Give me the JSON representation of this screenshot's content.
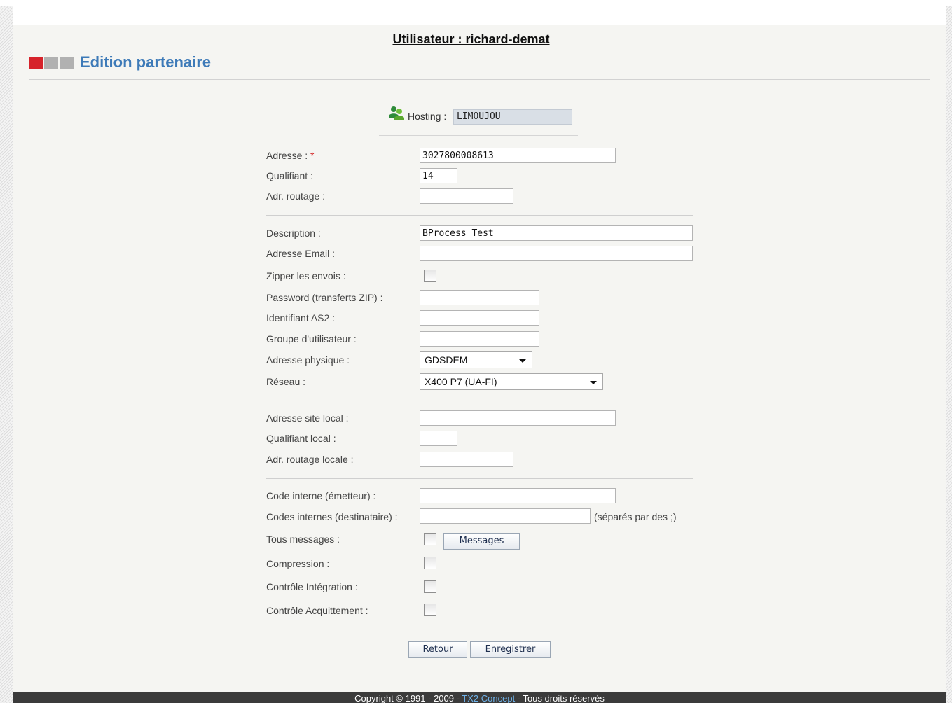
{
  "header": {
    "user_title": "Utilisateur : richard-demat",
    "page_title": "Edition partenaire",
    "logo_colors": [
      "#d6232b",
      "#b1b1b1",
      "#b1b1b1"
    ]
  },
  "hosting": {
    "icon": "users-icon",
    "label": "Hosting :",
    "value": "LIMOUJOU"
  },
  "form": {
    "adresse": {
      "label": "Adresse :",
      "required_mark": "*",
      "value": "3027800008613"
    },
    "qualifiant": {
      "label": "Qualifiant :",
      "value": "14"
    },
    "adr_routage": {
      "label": "Adr. routage :",
      "value": ""
    },
    "description": {
      "label": "Description :",
      "value": "BProcess Test"
    },
    "adresse_email": {
      "label": "Adresse Email :",
      "value": ""
    },
    "zipper": {
      "label": "Zipper les envois :",
      "checked": false
    },
    "password_zip": {
      "label": "Password (transferts ZIP) :",
      "value": ""
    },
    "identifiant_as2": {
      "label": "Identifiant AS2 :",
      "value": ""
    },
    "groupe_utilisateur": {
      "label": "Groupe d'utilisateur :",
      "value": ""
    },
    "adresse_physique": {
      "label": "Adresse physique :",
      "selected": "GDSDEM"
    },
    "reseau": {
      "label": "Réseau :",
      "selected": "X400 P7 (UA-FI)"
    },
    "adresse_site_local": {
      "label": "Adresse site local :",
      "value": ""
    },
    "qualifiant_local": {
      "label": "Qualifiant local :",
      "value": ""
    },
    "adr_routage_locale": {
      "label": "Adr. routage locale :",
      "value": ""
    },
    "code_interne_emetteur": {
      "label": "Code interne (émetteur) :",
      "value": ""
    },
    "codes_internes_destinataire": {
      "label": "Codes internes (destinataire) :",
      "value": "",
      "hint": "(séparés par des ;)"
    },
    "tous_messages": {
      "label": "Tous messages :",
      "checked": false,
      "button_label": "Messages"
    },
    "compression": {
      "label": "Compression :",
      "checked": false
    },
    "controle_integration": {
      "label": "Contrôle Intégration :",
      "checked": false
    },
    "controle_acquittement": {
      "label": "Contrôle Acquittement :",
      "checked": false
    }
  },
  "actions": {
    "retour_label": "Retour",
    "enregistrer_label": "Enregistrer"
  },
  "footer": {
    "prefix": "Copyright © 1991 - 2009 - ",
    "link": "TX2 Concept",
    "suffix": " - Tous droits réservés"
  }
}
